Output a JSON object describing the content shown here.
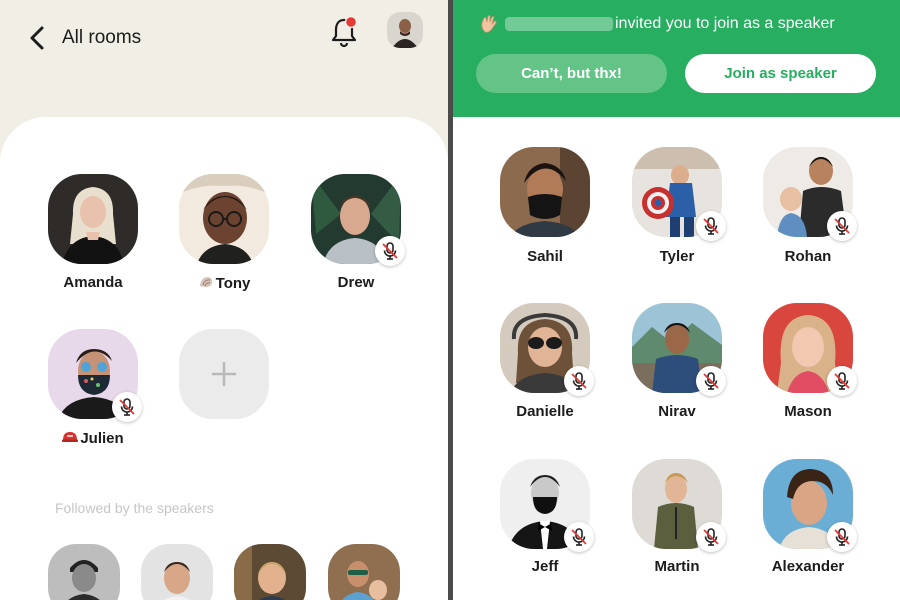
{
  "header": {
    "back_label": "All rooms",
    "back_icon": "chevron-left-icon",
    "notification_icon": "bell-icon",
    "notification_dot_color": "#e53935"
  },
  "stage": {
    "speakers": [
      {
        "name": "Amanda",
        "emoji": "",
        "muted": false
      },
      {
        "name": "Tony",
        "emoji": "shell",
        "muted": false
      },
      {
        "name": "Drew",
        "emoji": "",
        "muted": true
      },
      {
        "name": "Julien",
        "emoji": "red-helmet",
        "muted": true
      }
    ],
    "add_icon": "plus-icon"
  },
  "followed": {
    "label": "Followed by the speakers"
  },
  "invite": {
    "text": "invited you to join as a speaker",
    "decline_label": "Can’t, but thx!",
    "join_label": "Join as speaker",
    "accent_color": "#27ae60"
  },
  "listeners": [
    {
      "name": "Sahil",
      "muted": false
    },
    {
      "name": "Tyler",
      "muted": true
    },
    {
      "name": "Rohan",
      "muted": true
    },
    {
      "name": "Danielle",
      "muted": true
    },
    {
      "name": "Nirav",
      "muted": true
    },
    {
      "name": "Mason",
      "muted": true
    },
    {
      "name": "Jeff",
      "muted": true
    },
    {
      "name": "Martin",
      "muted": true
    },
    {
      "name": "Alexander",
      "muted": true
    }
  ]
}
